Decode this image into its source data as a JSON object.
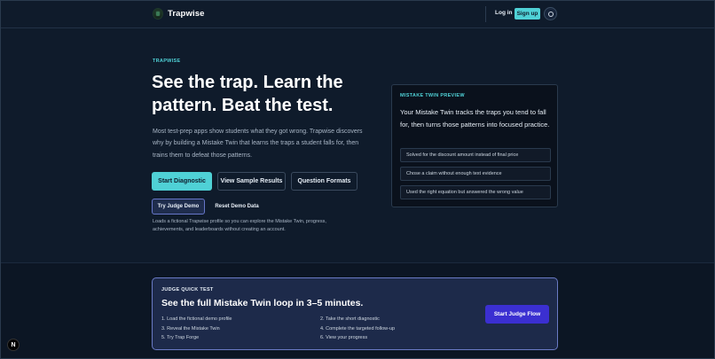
{
  "header": {
    "brand": "Trapwise",
    "login": "Log in",
    "signup": "Sign up"
  },
  "hero": {
    "eyebrow": "TRAPWISE",
    "title": "See the trap. Learn the pattern. Beat the test.",
    "description": "Most test-prep apps show students what they got wrong. Trapwise discovers why by building a Mistake Twin that learns the traps a student falls for, then trains them to defeat those patterns.",
    "buttons": {
      "start": "Start Diagnostic",
      "sample": "View Sample Results",
      "formats": "Question Formats"
    },
    "demo": {
      "judge": "Try Judge Demo",
      "reset": "Reset Demo Data",
      "note": "Loads a fictional Trapwise profile so you can explore the Mistake Twin, progress, achievements, and leaderboards without creating an account."
    }
  },
  "preview": {
    "label": "MISTAKE TWIN PREVIEW",
    "text": "Your Mistake Twin tracks the traps you tend to fall for, then turns those patterns into focused practice.",
    "mistakes": [
      "Solved for the discount amount instead of final price",
      "Chose a claim without enough text evidence",
      "Used the right equation but answered the wrong value"
    ]
  },
  "judge": {
    "eyebrow": "JUDGE QUICK TEST",
    "title": "See the full Mistake Twin loop in 3–5 minutes.",
    "steps_left": [
      "1. Load the fictional demo profile",
      "3. Reveal the Mistake Twin",
      "5. Try Trap Forge"
    ],
    "steps_right": [
      "2. Take the short diagnostic",
      "4. Complete the targeted follow-up",
      "6. View your progress"
    ],
    "button": "Start Judge Flow"
  },
  "dev_badge": "N"
}
